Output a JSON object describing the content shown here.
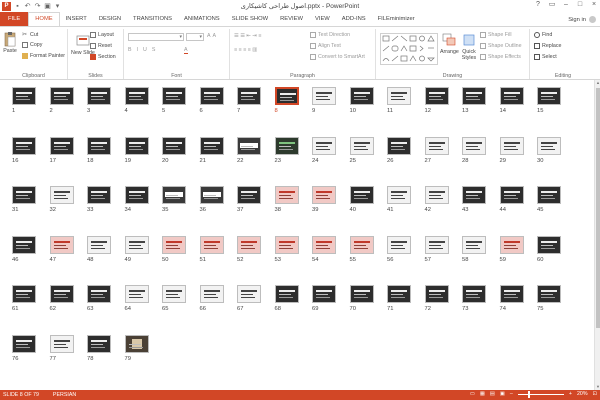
{
  "window": {
    "title": "اصول طراحی کاشیکاری.pptx - PowerPoint",
    "app_icon": "P",
    "controls": [
      "?",
      "▭",
      "–",
      "□",
      "×"
    ]
  },
  "tabs": [
    {
      "label": "FILE",
      "kind": "file"
    },
    {
      "label": "HOME",
      "kind": "active"
    },
    {
      "label": "INSERT"
    },
    {
      "label": "DESIGN"
    },
    {
      "label": "TRANSITIONS"
    },
    {
      "label": "ANIMATIONS"
    },
    {
      "label": "SLIDE SHOW"
    },
    {
      "label": "REVIEW"
    },
    {
      "label": "VIEW"
    },
    {
      "label": "ADD-INS"
    },
    {
      "label": "FILEminimizer"
    }
  ],
  "signin": "Sign in",
  "ribbon": {
    "clipboard": {
      "label": "Clipboard",
      "paste": "Paste",
      "cut": "Cut",
      "copy": "Copy",
      "format_painter": "Format Painter"
    },
    "slides": {
      "label": "Slides",
      "new_slide": "New Slide",
      "layout": "Layout",
      "reset": "Reset",
      "section": "Section"
    },
    "font": {
      "label": "Font"
    },
    "paragraph": {
      "label": "Paragraph",
      "text_direction": "Text Direction",
      "align_text": "Align Text",
      "convert_smartart": "Convert to SmartArt"
    },
    "drawing": {
      "label": "Drawing",
      "arrange": "Arrange",
      "quick_styles": "Quick Styles",
      "shape_fill": "Shape Fill",
      "shape_outline": "Shape Outline",
      "shape_effects": "Shape Effects"
    },
    "editing": {
      "label": "Editing",
      "find": "Find",
      "replace": "Replace",
      "select": "Select"
    }
  },
  "slides": {
    "count": 79,
    "selected": 8,
    "variants": [
      "d",
      "d",
      "d",
      "d",
      "d",
      "d",
      "d",
      "d",
      "w",
      "d",
      "w",
      "d",
      "d",
      "d",
      "d",
      "d",
      "d",
      "d",
      "d",
      "d",
      "d",
      "m",
      "g",
      "w",
      "w",
      "d",
      "w",
      "w",
      "w",
      "w",
      "d",
      "w",
      "d",
      "d",
      "m",
      "m",
      "d",
      "p",
      "p",
      "d",
      "w",
      "w",
      "d",
      "d",
      "d",
      "d",
      "p",
      "w",
      "w",
      "p",
      "p",
      "p",
      "p",
      "p",
      "p",
      "w",
      "w",
      "w",
      "p",
      "d",
      "d",
      "d",
      "d",
      "w",
      "w",
      "w",
      "w",
      "d",
      "d",
      "d",
      "d",
      "d",
      "d",
      "d",
      "d",
      "d",
      "w",
      "d",
      "h"
    ]
  },
  "status": {
    "slide": "SLIDE 8 OF 79",
    "language": "PERSIAN",
    "zoom": "20%"
  }
}
